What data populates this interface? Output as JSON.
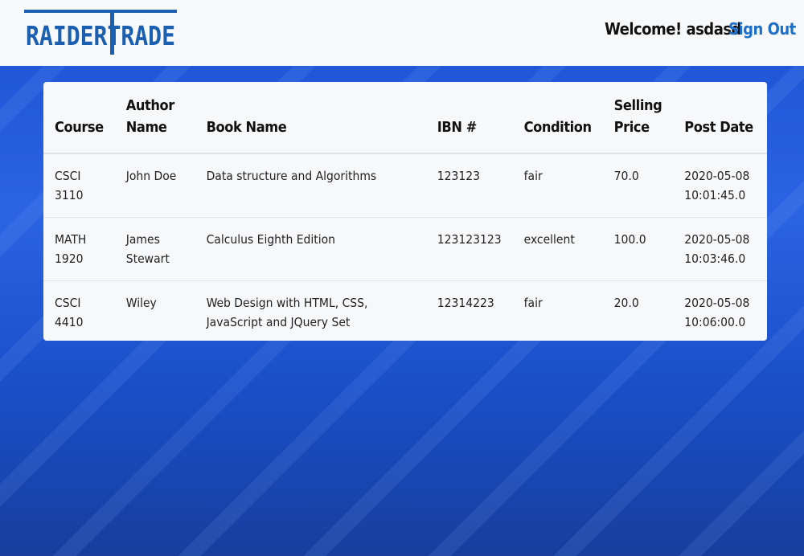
{
  "header": {
    "logo_text": "RAIDERTRADE",
    "welcome": "Welcome! asdasd",
    "signout_label": "Sign Out"
  },
  "colors": {
    "accent": "#1d6fc7",
    "logo": "#1a5fb0",
    "background": "#1e5ed6"
  },
  "table": {
    "headers": [
      "Course",
      "Author Name",
      "Book Name",
      "IBN #",
      "Condition",
      "Selling Price",
      "Post Date"
    ],
    "rows": [
      [
        "CSCI 3110",
        "John Doe",
        "Data structure and Algorithms",
        "123123",
        "fair",
        "70.0",
        "2020-05-08 10:01:45.0"
      ],
      [
        "MATH 1920",
        "James Stewart",
        "Calculus Eighth Edition",
        "123123123",
        "excellent",
        "100.0",
        "2020-05-08 10:03:46.0"
      ],
      [
        "CSCI 4410",
        "Wiley",
        "Web Design with HTML, CSS, JavaScript and JQuery Set",
        "12314223",
        "fair",
        "20.0",
        "2020-05-08 10:06:00.0"
      ]
    ]
  }
}
